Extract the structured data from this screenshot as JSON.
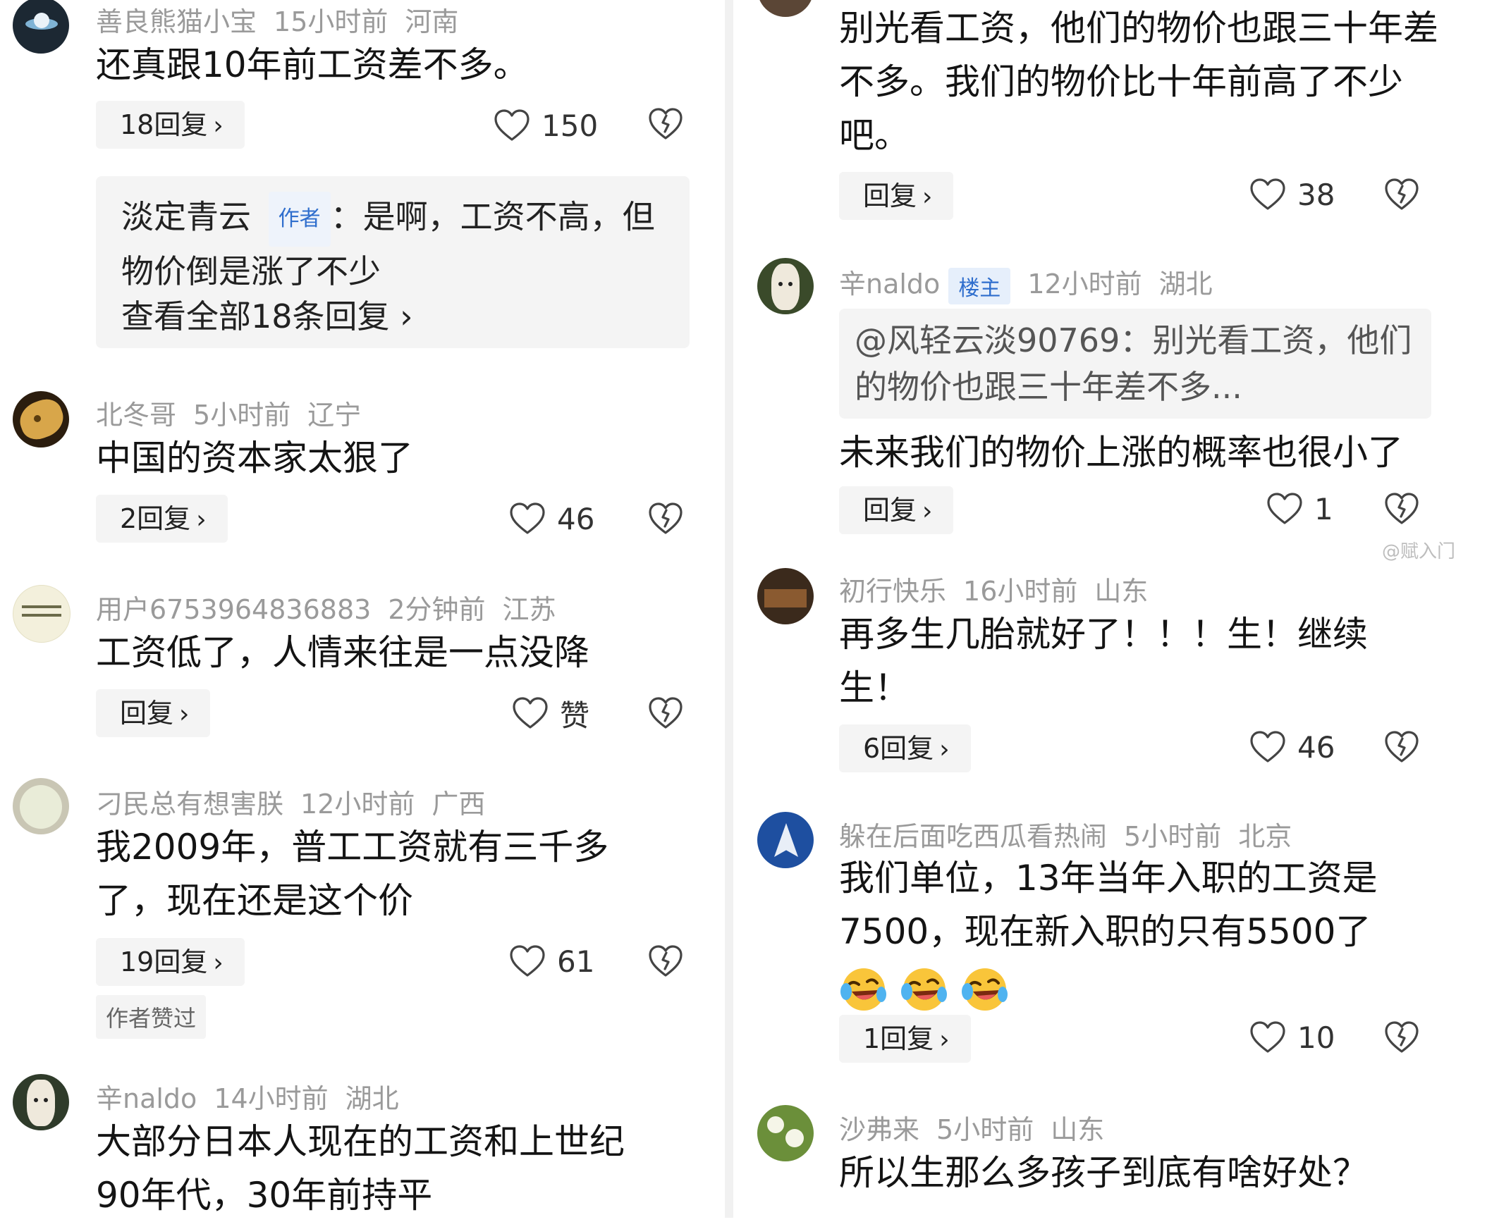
{
  "left": {
    "c1": {
      "user": "善良熊猫小宝",
      "time": "15小时前",
      "location": "河南",
      "text": "还真跟10年前工资差不多。",
      "reply_btn": "18回复",
      "likes": "150",
      "preview": {
        "author": "淡定青云",
        "author_tag": "作者",
        "text": "：是啊，工资不高，但物价倒是涨了不少",
        "view_all": "查看全部18条回复"
      }
    },
    "c2": {
      "user": "北冬哥",
      "time": "5小时前",
      "location": "辽宁",
      "text": "中国的资本家太狠了",
      "reply_btn": "2回复",
      "likes": "46"
    },
    "c3": {
      "user": "用户6753964836883",
      "time": "2分钟前",
      "location": "江苏",
      "text": "工资低了，人情来往是一点没降",
      "reply_btn": "回复",
      "likes": "赞"
    },
    "c4": {
      "user": "刁民总有想害朕",
      "time": "12小时前",
      "location": "广西",
      "text": "我2009年，普工工资就有三千多了，现在还是这个价",
      "reply_btn": "19回复",
      "likes": "61",
      "liked_tag": "作者赞过"
    },
    "c5": {
      "user": "辛naldo",
      "time": "14小时前",
      "location": "湖北",
      "text": "大部分日本人现在的工资和上世纪90年代，30年前持平"
    }
  },
  "right": {
    "c1": {
      "text": "别光看工资，他们的物价也跟三十年差不多。我们的物价比十年前高了不少吧。",
      "reply_btn": "回复",
      "likes": "38"
    },
    "c2": {
      "user": "辛naldo",
      "user_tag": "楼主",
      "time": "12小时前",
      "location": "湖北",
      "quote": "@风轻云淡90769：别光看工资，他们的物价也跟三十年差不多...",
      "text": "未来我们的物价上涨的概率也很小了",
      "reply_btn": "回复",
      "likes": "1"
    },
    "c3": {
      "user": "初行快乐",
      "time": "16小时前",
      "location": "山东",
      "text": "再多生几胎就好了！！！生！继续生！",
      "reply_btn": "6回复",
      "likes": "46"
    },
    "c4": {
      "user": "躲在后面吃西瓜看热闹",
      "time": "5小时前",
      "location": "北京",
      "text": "我们单位，13年当年入职的工资是7500，现在新入职的只有5500了",
      "reply_btn": "1回复",
      "likes": "10"
    },
    "c5": {
      "user": "沙弗来",
      "time": "5小时前",
      "location": "山东",
      "text": "所以生那么多孩子到底有啥好处？"
    },
    "watermark": "@赋入门"
  },
  "icons": {
    "like": "heart-outline-icon",
    "dislike": "broken-heart-icon",
    "chevron": "chevron-right-icon"
  },
  "colors": {
    "meta": "#9a9a9a",
    "pill_bg": "#f4f4f4",
    "badge_blue": "#2f6ecd"
  }
}
